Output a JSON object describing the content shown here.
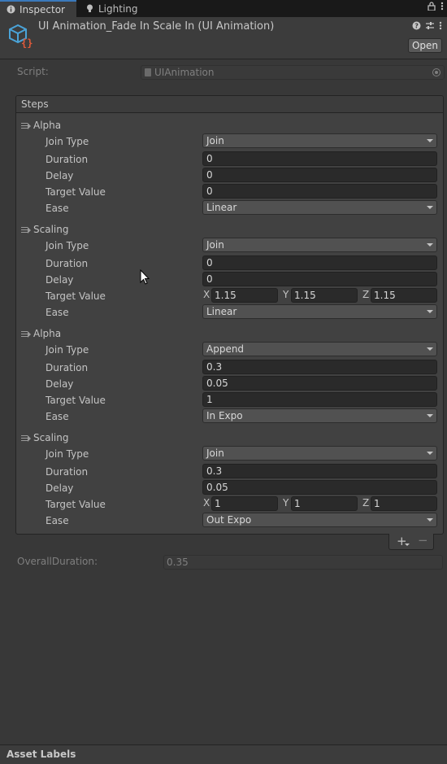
{
  "tabs": [
    {
      "label": "Inspector",
      "icon": "info-icon"
    },
    {
      "label": "Lighting",
      "icon": "lightbulb-icon"
    }
  ],
  "header": {
    "title": "UI Animation_Fade In Scale In (UI Animation)",
    "open_label": "Open"
  },
  "script": {
    "label": "Script:",
    "value": "UIAnimation"
  },
  "steps": {
    "title": "Steps",
    "items": [
      {
        "name": "Alpha",
        "join_type_label": "Join Type",
        "join_type": "Join",
        "duration_label": "Duration",
        "duration": "0",
        "delay_label": "Delay",
        "delay": "0",
        "target_label": "Target Value",
        "target": "0",
        "ease_label": "Ease",
        "ease": "Linear"
      },
      {
        "name": "Scaling",
        "join_type_label": "Join Type",
        "join_type": "Join",
        "duration_label": "Duration",
        "duration": "0",
        "delay_label": "Delay",
        "delay": "0",
        "target_label": "Target Value",
        "target_vec": {
          "x_label": "X",
          "x": "1.15",
          "y_label": "Y",
          "y": "1.15",
          "z_label": "Z",
          "z": "1.15"
        },
        "ease_label": "Ease",
        "ease": "Linear"
      },
      {
        "name": "Alpha",
        "join_type_label": "Join Type",
        "join_type": "Append",
        "duration_label": "Duration",
        "duration": "0.3",
        "delay_label": "Delay",
        "delay": "0.05",
        "target_label": "Target Value",
        "target": "1",
        "ease_label": "Ease",
        "ease": "In Expo"
      },
      {
        "name": "Scaling",
        "join_type_label": "Join Type",
        "join_type": "Join",
        "duration_label": "Duration",
        "duration": "0.3",
        "delay_label": "Delay",
        "delay": "0.05",
        "target_label": "Target Value",
        "target_vec": {
          "x_label": "X",
          "x": "1",
          "y_label": "Y",
          "y": "1",
          "z_label": "Z",
          "z": "1"
        },
        "ease_label": "Ease",
        "ease": "Out Expo"
      }
    ]
  },
  "list_footer": {
    "add_label": "+",
    "remove_label": "−"
  },
  "overall": {
    "label": "OverallDuration:",
    "value": "0.35"
  },
  "asset_labels": "Asset Labels",
  "colors": {
    "accent": "#3a79bb",
    "background": "#383838",
    "panel": "#414141",
    "field": "#2a2a2a"
  }
}
